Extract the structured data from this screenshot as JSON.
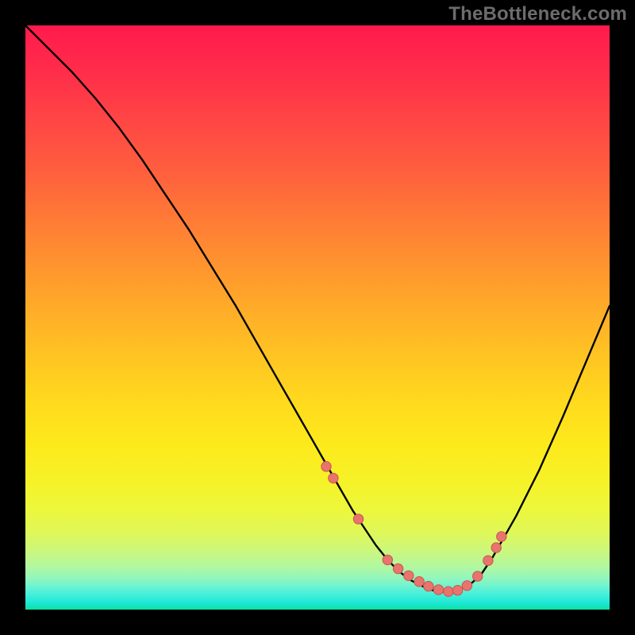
{
  "watermark": "TheBottleneck.com",
  "colors": {
    "background_outer": "#000000",
    "curve": "#000000",
    "dot_fill": "#e9746e",
    "dot_stroke": "#c9564f",
    "gradient_top": "#ff1a4d",
    "gradient_bottom": "#0fe0a0"
  },
  "chart_data": {
    "type": "line",
    "title": "",
    "xlabel": "",
    "ylabel": "",
    "xlim": [
      0,
      100
    ],
    "ylim": [
      0,
      100
    ],
    "grid": false,
    "legend": false,
    "series": [
      {
        "name": "bottleneck-curve",
        "x": [
          0,
          4,
          8,
          12,
          16,
          20,
          24,
          28,
          32,
          36,
          40,
          44,
          48,
          52,
          54,
          56,
          58,
          60,
          62,
          64,
          66,
          68,
          70,
          72,
          74,
          76,
          78,
          80,
          84,
          88,
          92,
          96,
          100
        ],
        "y": [
          100,
          96,
          92,
          87.5,
          82.5,
          77,
          71,
          65,
          58.5,
          52,
          45,
          38,
          31,
          24,
          20.5,
          17,
          14,
          11,
          8.5,
          6.5,
          5,
          4,
          3.2,
          3,
          3.3,
          4.2,
          6,
          9,
          16,
          24,
          33,
          42.5,
          52
        ]
      }
    ],
    "dots": {
      "name": "highlight-dots",
      "x": [
        51.5,
        52.7,
        57.0,
        62.0,
        63.8,
        65.6,
        67.4,
        69.0,
        70.7,
        72.4,
        74.0,
        75.6,
        77.4,
        79.2,
        80.6,
        81.5
      ],
      "y": [
        24.5,
        22.5,
        15.5,
        8.5,
        7.0,
        5.8,
        4.8,
        4.0,
        3.4,
        3.1,
        3.3,
        4.1,
        5.7,
        8.4,
        10.6,
        12.5
      ]
    }
  }
}
